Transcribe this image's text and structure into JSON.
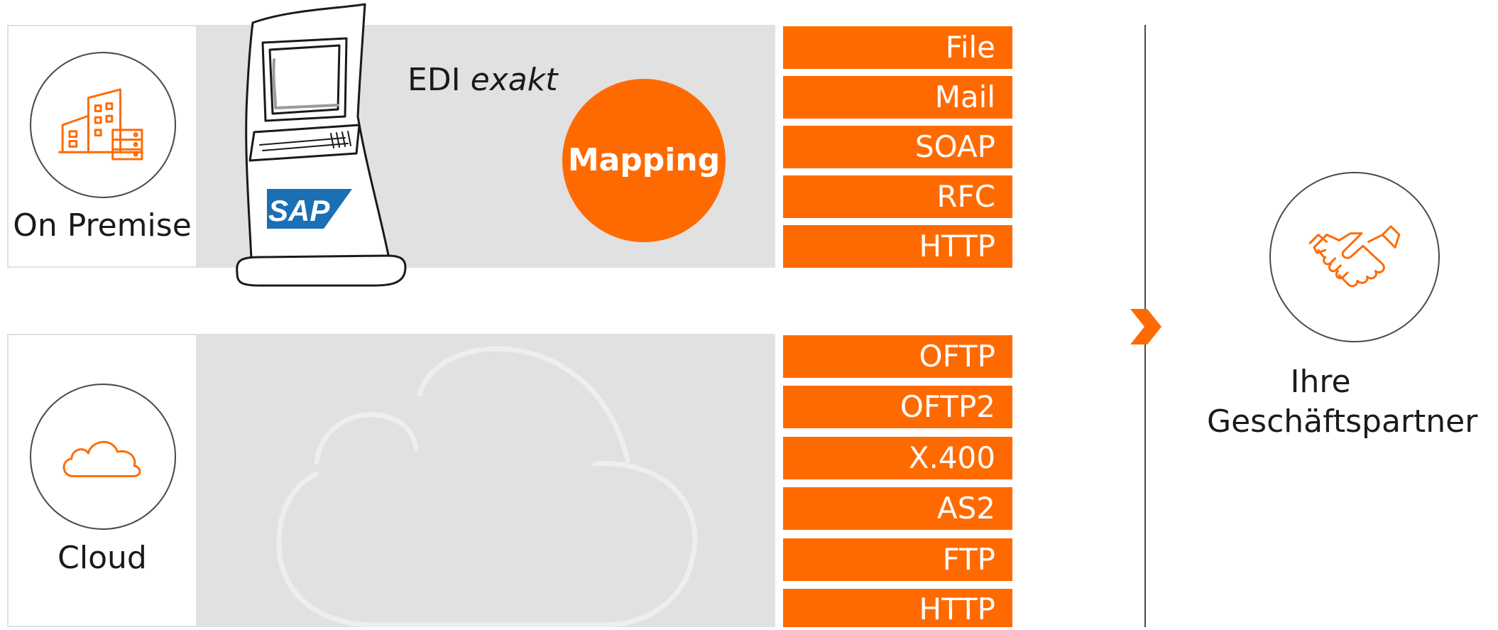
{
  "on_premise": {
    "label": "On Premise",
    "edi_name": "EDI",
    "edi_suffix": "exakt",
    "mapping": "Mapping",
    "sap_logo": "SAP",
    "protocols": [
      "File",
      "Mail",
      "SOAP",
      "RFC",
      "HTTP"
    ]
  },
  "cloud": {
    "label": "Cloud",
    "protocols": [
      "OFTP",
      "OFTP2",
      "X.400",
      "AS2",
      "FTP",
      "HTTP"
    ]
  },
  "partner": {
    "line1": "Ihre",
    "line2": "Geschäftspartner"
  },
  "icons": {
    "on_premise": "office-building-server-icon",
    "cloud": "cloud-icon",
    "partner": "handshake-icon",
    "arrow": "chevron-right-icon",
    "terminal": "sap-terminal-illustration"
  },
  "colors": {
    "accent": "#ff6a00",
    "panel": "#e1e1e1",
    "outline": "#4a4a4a"
  }
}
